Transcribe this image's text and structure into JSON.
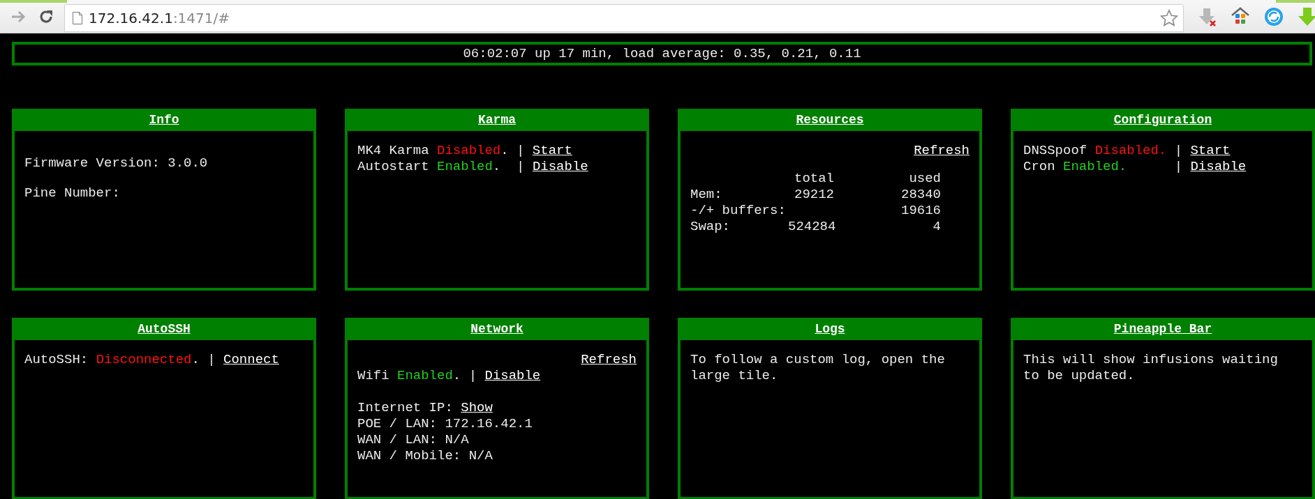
{
  "browser": {
    "address": {
      "host": "172.16.42.1",
      "rest": ":1471/#"
    }
  },
  "uptime": "06:02:07 up 17 min, load average: 0.35, 0.21, 0.11",
  "tiles": [
    {
      "title": "Info",
      "kind": "info",
      "groups": [
        [
          [
            {
              "kind": "text",
              "text": "Firmware Version: 3.0.0"
            }
          ]
        ],
        [
          [
            {
              "kind": "text",
              "text": "Pine Number:"
            }
          ]
        ]
      ]
    },
    {
      "title": "Karma",
      "kind": "lines",
      "groups": [
        [
          [
            {
              "kind": "text",
              "text": "MK4 Karma "
            },
            {
              "kind": "status",
              "text": "Disabled",
              "on": false
            },
            {
              "kind": "text",
              "text": ". | "
            },
            {
              "kind": "link",
              "text": "Start"
            }
          ],
          [
            {
              "kind": "text",
              "text": "Autostart "
            },
            {
              "kind": "status",
              "text": "Enabled",
              "on": true
            },
            {
              "kind": "text",
              "text": ".  | "
            },
            {
              "kind": "link",
              "text": "Disable"
            }
          ]
        ]
      ]
    },
    {
      "title": "Resources",
      "kind": "table",
      "refresh": "Refresh",
      "table": {
        "columns": [
          "total",
          "used"
        ],
        "rows": [
          {
            "label": "Mem:",
            "cells": [
              "29212",
              "28340"
            ]
          },
          {
            "label": "-/+ buffers:",
            "cells": [
              null,
              "19616"
            ]
          },
          {
            "label": "Swap:",
            "cells": [
              "524284",
              "4"
            ]
          }
        ]
      }
    },
    {
      "title": "Configuration",
      "kind": "lines",
      "groups": [
        [
          [
            {
              "kind": "text",
              "text": "DNSSpoof "
            },
            {
              "kind": "status",
              "text": "Disabled.",
              "on": false
            },
            {
              "kind": "text",
              "text": " | "
            },
            {
              "kind": "link",
              "text": "Start"
            }
          ],
          [
            {
              "kind": "text",
              "text": "Cron "
            },
            {
              "kind": "status",
              "text": "Enabled.",
              "on": true
            },
            {
              "kind": "text",
              "text": "      | "
            },
            {
              "kind": "link",
              "text": "Disable"
            }
          ]
        ]
      ]
    },
    {
      "title": "AutoSSH",
      "kind": "lines",
      "groups": [
        [
          [
            {
              "kind": "text",
              "text": "AutoSSH: "
            },
            {
              "kind": "status",
              "text": "Disconnected",
              "on": false
            },
            {
              "kind": "text",
              "text": ". | "
            },
            {
              "kind": "link",
              "text": "Connect"
            }
          ]
        ]
      ]
    },
    {
      "title": "Network",
      "kind": "lines",
      "refresh": "Refresh",
      "groups": [
        [
          [
            {
              "kind": "text",
              "text": "Wifi "
            },
            {
              "kind": "status",
              "text": "Enabled",
              "on": true
            },
            {
              "kind": "text",
              "text": ". | "
            },
            {
              "kind": "link",
              "text": "Disable"
            }
          ]
        ],
        [
          [
            {
              "kind": "text",
              "text": "Internet IP: "
            },
            {
              "kind": "link",
              "text": "Show"
            }
          ],
          [
            {
              "kind": "text",
              "text": "POE / LAN: 172.16.42.1"
            }
          ],
          [
            {
              "kind": "text",
              "text": "WAN / LAN: N/A"
            }
          ],
          [
            {
              "kind": "text",
              "text": "WAN / Mobile: N/A"
            }
          ]
        ]
      ]
    },
    {
      "title": "Logs",
      "kind": "paragraph",
      "text": "To follow a custom log, open the large tile."
    },
    {
      "title": "Pineapple Bar",
      "kind": "paragraph",
      "text": "This will show infusions waiting to be updated."
    }
  ]
}
